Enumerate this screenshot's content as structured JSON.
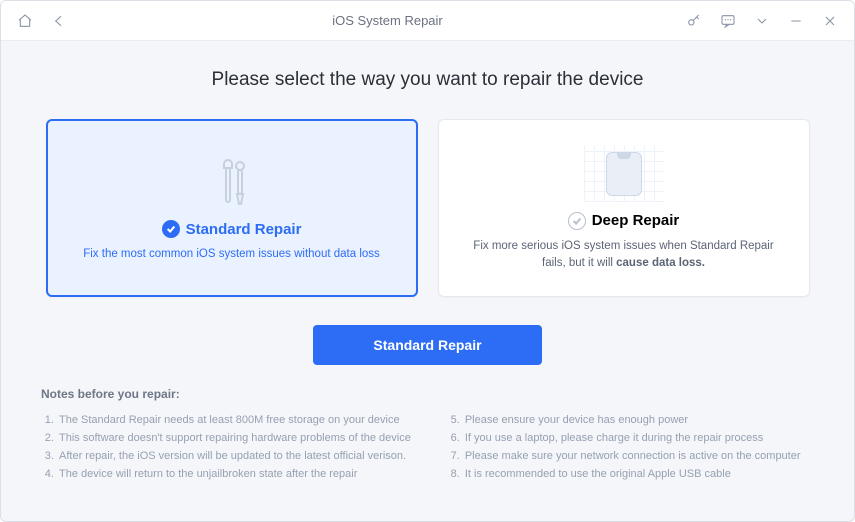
{
  "window_title": "iOS System Repair",
  "heading": "Please select the way you want to repair the device",
  "cards": {
    "standard": {
      "title": "Standard Repair",
      "desc": "Fix the most common iOS system issues without data loss",
      "selected": true
    },
    "deep": {
      "title": "Deep Repair",
      "desc_prefix": "Fix more serious iOS system issues when Standard Repair fails, but it will ",
      "desc_bold": "cause data loss.",
      "selected": false
    }
  },
  "primary_button": "Standard Repair",
  "notes_title": "Notes before you repair:",
  "notes_left": [
    "The Standard Repair needs at least 800M free storage on your device",
    "This software doesn't support repairing hardware problems of the device",
    "After repair, the iOS version will be updated to the latest official verison.",
    "The device will return to the unjailbroken state after the repair"
  ],
  "notes_right": [
    "Please ensure your device has enough power",
    "If you use a laptop, please charge it during the repair process",
    "Please make sure your network connection is active on the computer",
    "It is recommended to use the original Apple USB cable"
  ]
}
